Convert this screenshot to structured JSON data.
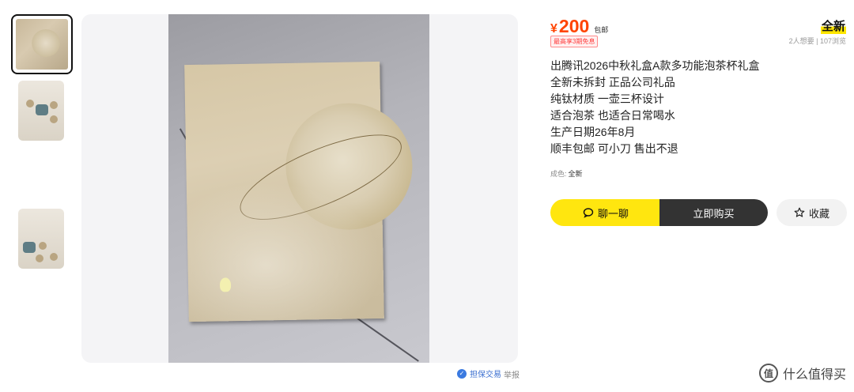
{
  "thumbnails": [
    {
      "name": "thumb-gift-box",
      "active": true
    },
    {
      "name": "thumb-tea-set-open",
      "active": false
    },
    {
      "name": "thumb-tea-set-display",
      "active": false
    }
  ],
  "gallery": {
    "guarantee_icon": "shield-icon",
    "guarantee_label": "担保交易",
    "report_label": "举报"
  },
  "product": {
    "currency": "¥",
    "price": "200",
    "shipping": "包邮",
    "promo": "最高享3期免息",
    "condition_badge": "全新",
    "stats": "2人想要 | 107浏览",
    "description_lines": [
      "出腾讯2026中秋礼盒A款多功能泡茶杯礼盒",
      "全新未拆封 正品公司礼品",
      "纯钛材质 一壶三杯设计",
      "适合泡茶 也适合日常喝水",
      "生产日期26年8月",
      "顺丰包邮 可小刀 售出不退"
    ],
    "condition_label": "成色:",
    "condition_value": "全新"
  },
  "actions": {
    "chat_label": "聊一聊",
    "chat_icon": "chat-bubble-icon",
    "buy_label": "立即购买",
    "favorite_label": "收藏",
    "favorite_icon": "star-icon"
  },
  "watermark": {
    "badge": "值",
    "text": "什么值得买"
  },
  "colors": {
    "price": "#ff4400",
    "chat_button": "#ffe60f",
    "buy_button": "#333333",
    "highlight": "#ffe600"
  }
}
